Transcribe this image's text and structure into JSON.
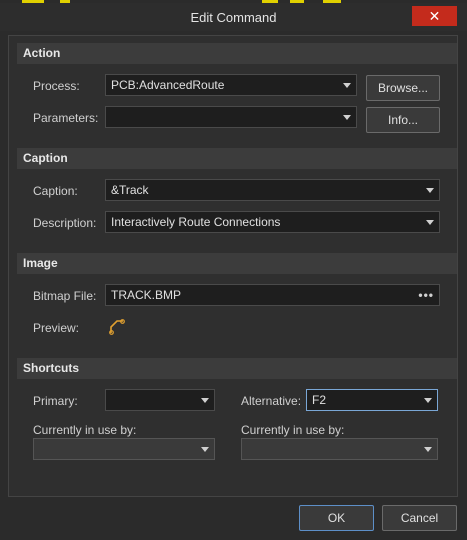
{
  "window": {
    "title": "Edit Command",
    "close_label": "✕"
  },
  "action": {
    "header": "Action",
    "process_label": "Process:",
    "process_value": "PCB:AdvancedRoute",
    "parameters_label": "Parameters:",
    "parameters_value": "",
    "browse_label": "Browse...",
    "info_label": "Info..."
  },
  "caption": {
    "header": "Caption",
    "caption_label": "Caption:",
    "caption_value": "&Track",
    "description_label": "Description:",
    "description_value": "Interactively Route Connections"
  },
  "image": {
    "header": "Image",
    "bitmap_label": "Bitmap File:",
    "bitmap_value": "TRACK.BMP",
    "bitmap_button": "•••",
    "preview_label": "Preview:",
    "preview_icon": "track-route-icon"
  },
  "shortcuts": {
    "header": "Shortcuts",
    "primary_label": "Primary:",
    "primary_value": "",
    "alternative_label": "Alternative:",
    "alternative_value": "F2",
    "in_use_label_left": "Currently in use by:",
    "in_use_value_left": "",
    "in_use_label_right": "Currently in use by:",
    "in_use_value_right": ""
  },
  "footer": {
    "ok_label": "OK",
    "cancel_label": "Cancel"
  },
  "colors": {
    "accent": "#c42b1c",
    "icon": "#e0a030",
    "focus": "#7aa7d6"
  }
}
